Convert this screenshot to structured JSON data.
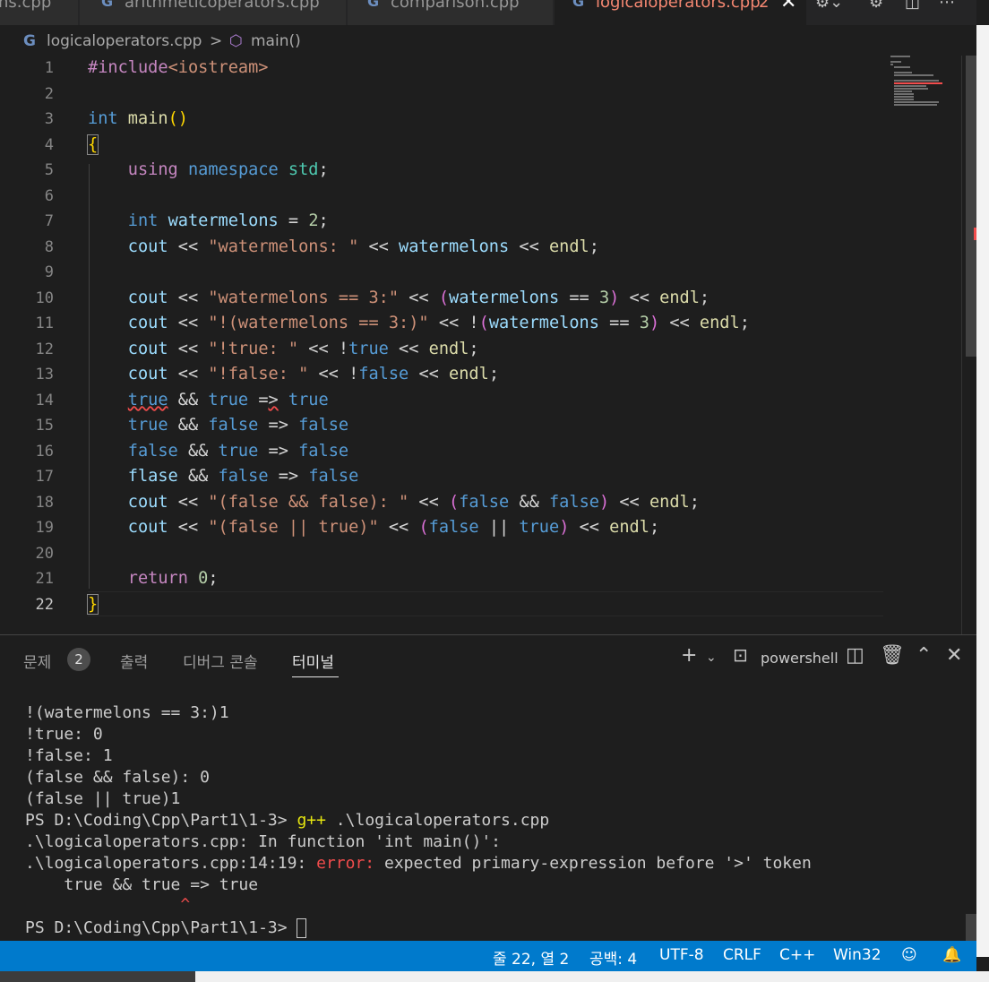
{
  "tabs": [
    {
      "label": "ns.cpp",
      "active": false
    },
    {
      "label": "arithmeticoperators.cpp",
      "active": false
    },
    {
      "label": "comparison.cpp",
      "active": false
    },
    {
      "label": "logicaloperators.cpp",
      "active": true,
      "problems": "2"
    }
  ],
  "breadcrumb": {
    "file": "logicaloperators.cpp",
    "separator": ">",
    "symbol": "main()"
  },
  "editor": {
    "line_numbers": [
      "1",
      "2",
      "3",
      "4",
      "5",
      "6",
      "7",
      "8",
      "9",
      "10",
      "11",
      "12",
      "13",
      "14",
      "15",
      "16",
      "17",
      "18",
      "19",
      "20",
      "21",
      "22"
    ],
    "current_line": "22"
  },
  "panel": {
    "tabs": [
      {
        "label": "문제",
        "badge": "2"
      },
      {
        "label": "출력"
      },
      {
        "label": "디버그 콘솔"
      },
      {
        "label": "터미널",
        "active": true
      }
    ],
    "shell": "powershell",
    "terminal_lines": [
      "!(watermelons == 3:)1",
      "!true: 0",
      "!false: 1",
      "(false && false): 0",
      "(false || true)1"
    ],
    "prompt": "PS D:\\Coding\\Cpp\\Part1\\1-3>",
    "command_name": "g++",
    "command_args": " .\\logicaloperators.cpp",
    "error_context": ".\\logicaloperators.cpp: In function 'int main()':",
    "error_location": ".\\logicaloperators.cpp:14:19:",
    "error_label": "error:",
    "error_message": " expected primary-expression before '>' token",
    "error_source": "    true && true => true",
    "error_caret": "                ^"
  },
  "statusbar": {
    "position": "줄 22, 열 2",
    "spaces": "공백: 4",
    "encoding": "UTF-8",
    "eol": "CRLF",
    "language": "C++",
    "platform": "Win32"
  },
  "colors": {
    "accent": "#007acc",
    "error": "#f14c4c",
    "keyword": "#569cd6",
    "string": "#ce9178"
  }
}
